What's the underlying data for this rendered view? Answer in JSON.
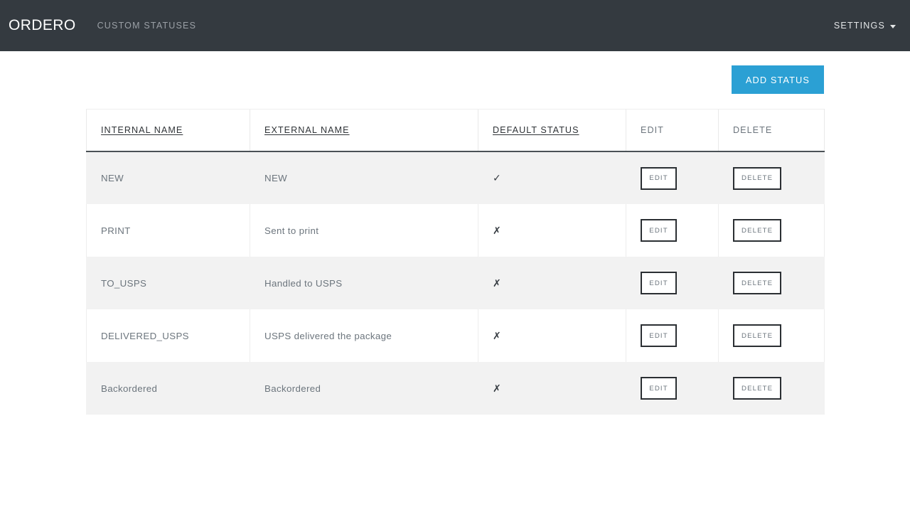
{
  "navbar": {
    "brand": "ORDERO",
    "links": [
      {
        "label": "CUSTOM STATUSES"
      }
    ],
    "settings": {
      "label": "SETTINGS",
      "caret_icon": "chevron-down-icon"
    },
    "background_color": "#343a40"
  },
  "toolbar": {
    "add_status_label": "ADD STATUS",
    "accent_color": "#2ba0d4"
  },
  "table": {
    "columns": [
      {
        "label": "INTERNAL NAME",
        "sortable": true
      },
      {
        "label": "EXTERNAL NAME",
        "sortable": true
      },
      {
        "label": "DEFAULT STATUS",
        "sortable": true
      },
      {
        "label": "EDIT",
        "sortable": false
      },
      {
        "label": "DELETE",
        "sortable": false
      }
    ],
    "row_actions": {
      "edit_label": "EDIT",
      "delete_label": "DELETE"
    },
    "marks": {
      "yes": "✓",
      "no": "✗"
    },
    "rows": [
      {
        "internal_name": "NEW",
        "external_name": "NEW",
        "default_status": "✓",
        "edit_label": "EDIT",
        "delete_label": "DELETE"
      },
      {
        "internal_name": "PRINT",
        "external_name": "Sent to print",
        "default_status": "✗",
        "edit_label": "EDIT",
        "delete_label": "DELETE"
      },
      {
        "internal_name": "TO_USPS",
        "external_name": "Handled to USPS",
        "default_status": "✗",
        "edit_label": "EDIT",
        "delete_label": "DELETE"
      },
      {
        "internal_name": "DELIVERED_USPS",
        "external_name": "USPS delivered the package",
        "default_status": "✗",
        "edit_label": "EDIT",
        "delete_label": "DELETE"
      },
      {
        "internal_name": "Backordered",
        "external_name": "Backordered",
        "default_status": "✗",
        "edit_label": "EDIT",
        "delete_label": "DELETE"
      }
    ]
  }
}
